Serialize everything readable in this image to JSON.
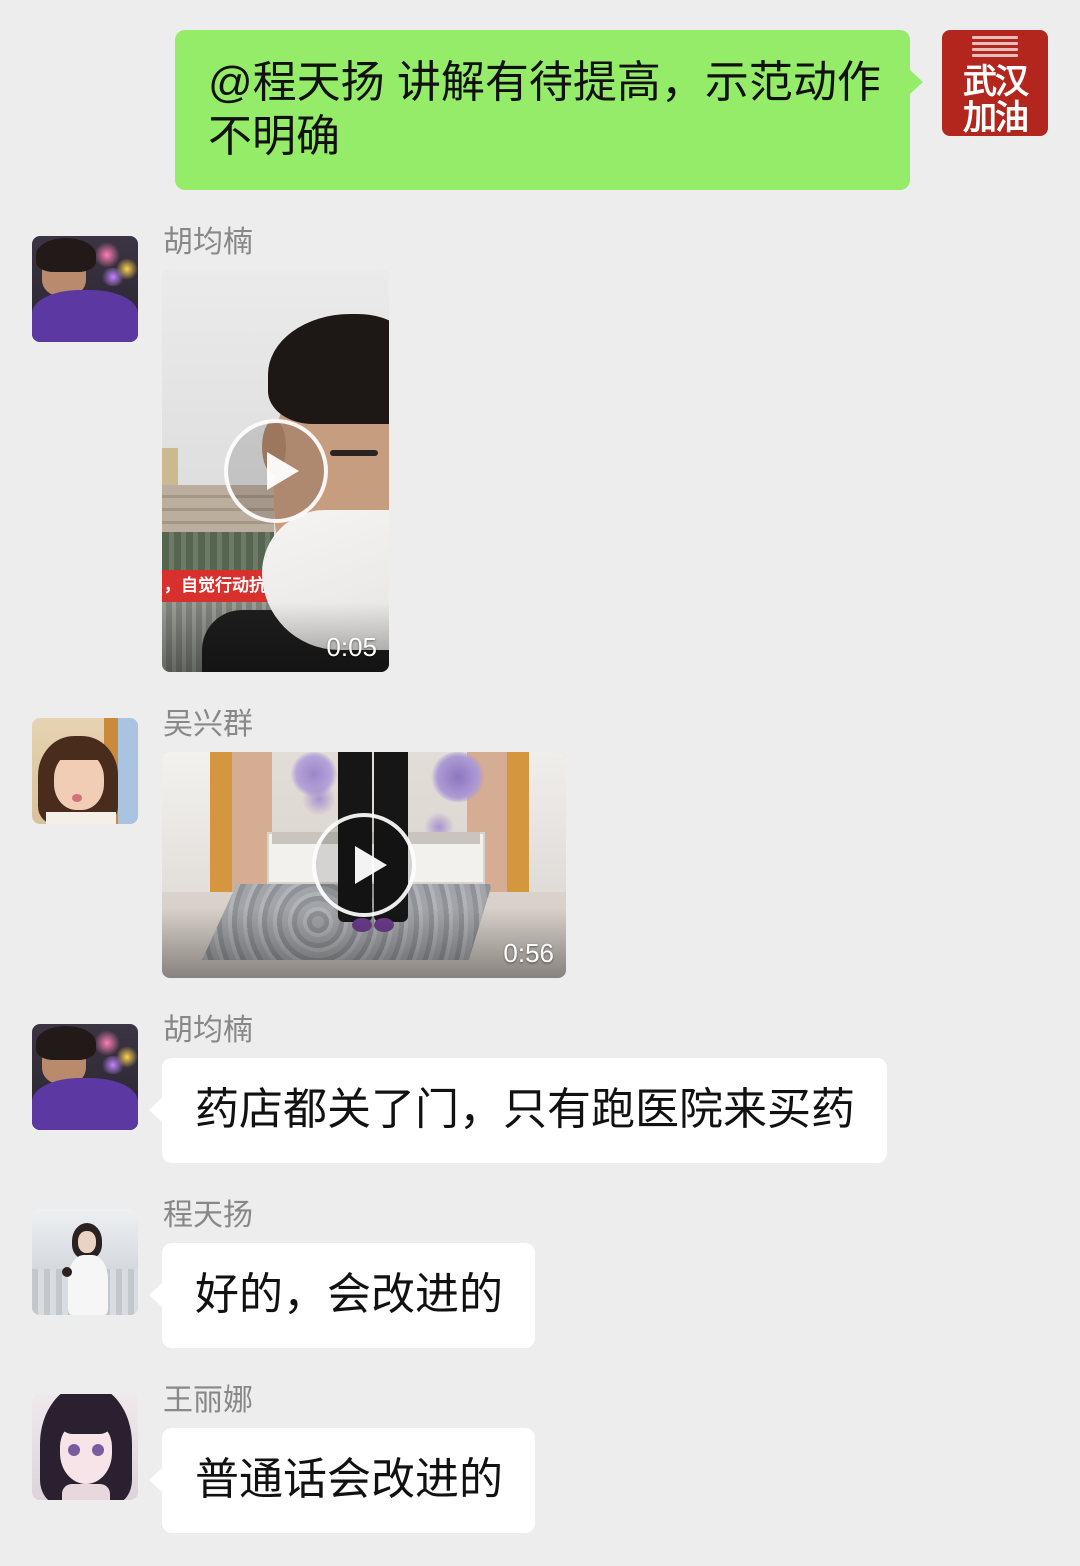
{
  "colors": {
    "background": "#ededed",
    "outgoing_bubble": "#95ec69",
    "incoming_bubble": "#ffffff",
    "sender_name": "#888888",
    "message_text": "#111111"
  },
  "messages": [
    {
      "direction": "outgoing",
      "type": "text",
      "text": "@程天扬 讲解有待提高，示范动作不明确",
      "avatar": {
        "icon": "wuhan-jiayou-avatar",
        "caption_top": "武汉",
        "caption_bottom": "加油"
      }
    },
    {
      "direction": "incoming",
      "type": "video",
      "sender": "胡均楠",
      "duration": "0:05",
      "thumbnail_banner_text": "，自觉行动抗疫",
      "avatar": {
        "icon": "person-purple-hoodie-avatar"
      }
    },
    {
      "direction": "incoming",
      "type": "video",
      "sender": "吴兴群",
      "duration": "0:56",
      "avatar": {
        "icon": "little-girl-avatar"
      }
    },
    {
      "direction": "incoming",
      "type": "text",
      "sender": "胡均楠",
      "text": "药店都关了门，只有跑医院来买药",
      "avatar": {
        "icon": "person-purple-hoodie-avatar"
      }
    },
    {
      "direction": "incoming",
      "type": "text",
      "sender": "程天扬",
      "text": "好的，会改进的",
      "avatar": {
        "icon": "woman-white-coat-avatar"
      }
    },
    {
      "direction": "incoming",
      "type": "text",
      "sender": "王丽娜",
      "text": "普通话会改进的",
      "avatar": {
        "icon": "anime-girl-avatar"
      }
    }
  ]
}
